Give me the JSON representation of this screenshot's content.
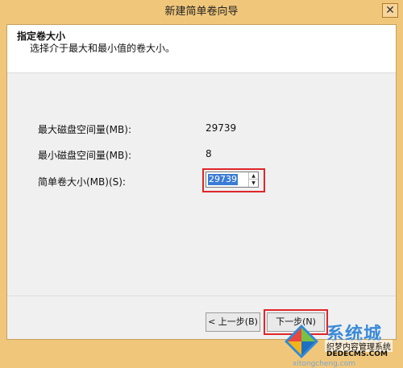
{
  "window": {
    "title": "新建简单卷向导",
    "close_glyph": "✕"
  },
  "header": {
    "title": "指定卷大小",
    "subtitle": "选择介于最大和最小值的卷大小。"
  },
  "fields": {
    "max_label": "最大磁盘空间量(MB):",
    "max_value": "29739",
    "min_label": "最小磁盘空间量(MB):",
    "min_value": "8",
    "size_label": "简单卷大小(MB)(S):",
    "size_value": "29739"
  },
  "buttons": {
    "back": "< 上一步(B)",
    "next": "下一步(N)"
  },
  "watermark": {
    "brand": "系统城",
    "line1": "织梦内容管理系统",
    "line2": "DEDECMS.COM",
    "line3": "xitongcheng.com"
  },
  "colors": {
    "highlight": "#e0262a",
    "titlebar": "#f0c77a",
    "selection": "#3a7bd5"
  },
  "icons": {
    "close": "close-icon",
    "up": "spin-up-icon",
    "down": "spin-down-icon"
  }
}
